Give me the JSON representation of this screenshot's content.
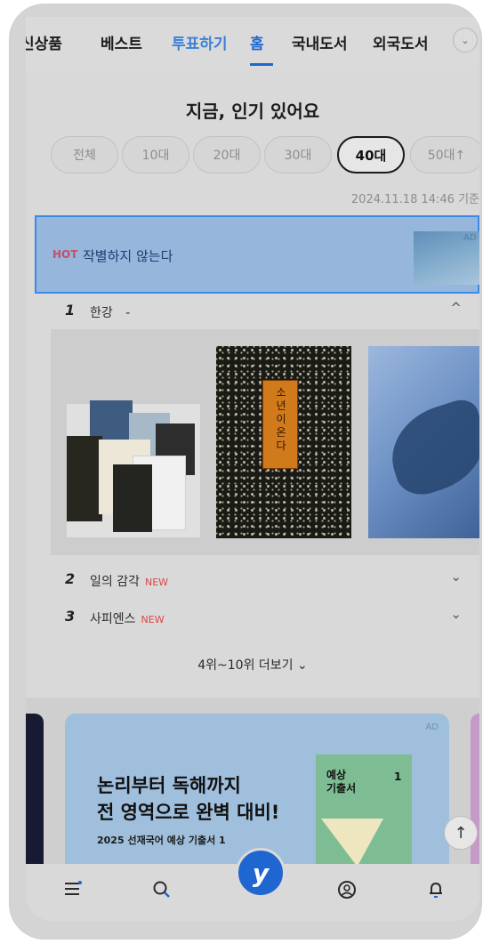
{
  "tabs": [
    {
      "label": "신상품"
    },
    {
      "label": "베스트"
    },
    {
      "label": "투표하기"
    },
    {
      "label": "홈"
    },
    {
      "label": "국내도서"
    },
    {
      "label": "외국도서"
    }
  ],
  "heading": "지금, 인기 있어요",
  "age_filters": [
    "전체",
    "10대",
    "20대",
    "30대",
    "40대",
    "50대↑"
  ],
  "selected_age": "40대",
  "timestamp": "2024.11.18 14:46 기준",
  "hot_banner": {
    "badge": "HOT",
    "title": "작별하지 않는다",
    "ad": "AD"
  },
  "rankings": [
    {
      "rank": "1",
      "title": "한강",
      "suffix": "-",
      "badge": "",
      "chevron": "^"
    },
    {
      "rank": "2",
      "title": "일의 감각",
      "badge": "NEW",
      "chevron": "⌄"
    },
    {
      "rank": "3",
      "title": "사피엔스",
      "badge": "NEW",
      "chevron": "⌄"
    }
  ],
  "featured_book_cover": "소년이 온다",
  "more_link": "4위~10위 더보기 ⌄",
  "ad_card": {
    "tag": "AD",
    "headline_1": "논리부터 독해까지",
    "headline_2": "전 영역으로 완벽 대비!",
    "subline": "2025 선재국어 예상 기출서 1",
    "book_title": "예상\n기출서",
    "book_volume": "1"
  },
  "bottom_nav": [
    {
      "icon": "menu-icon"
    },
    {
      "icon": "search-icon"
    },
    {
      "icon": "home-logo-icon",
      "glyph": "y"
    },
    {
      "icon": "profile-icon"
    },
    {
      "icon": "bell-icon"
    }
  ],
  "colors": {
    "accent": "#1f66d1",
    "hot": "#c0506a",
    "new_badge": "#d94848",
    "highlight_border": "#3c8ae8"
  }
}
